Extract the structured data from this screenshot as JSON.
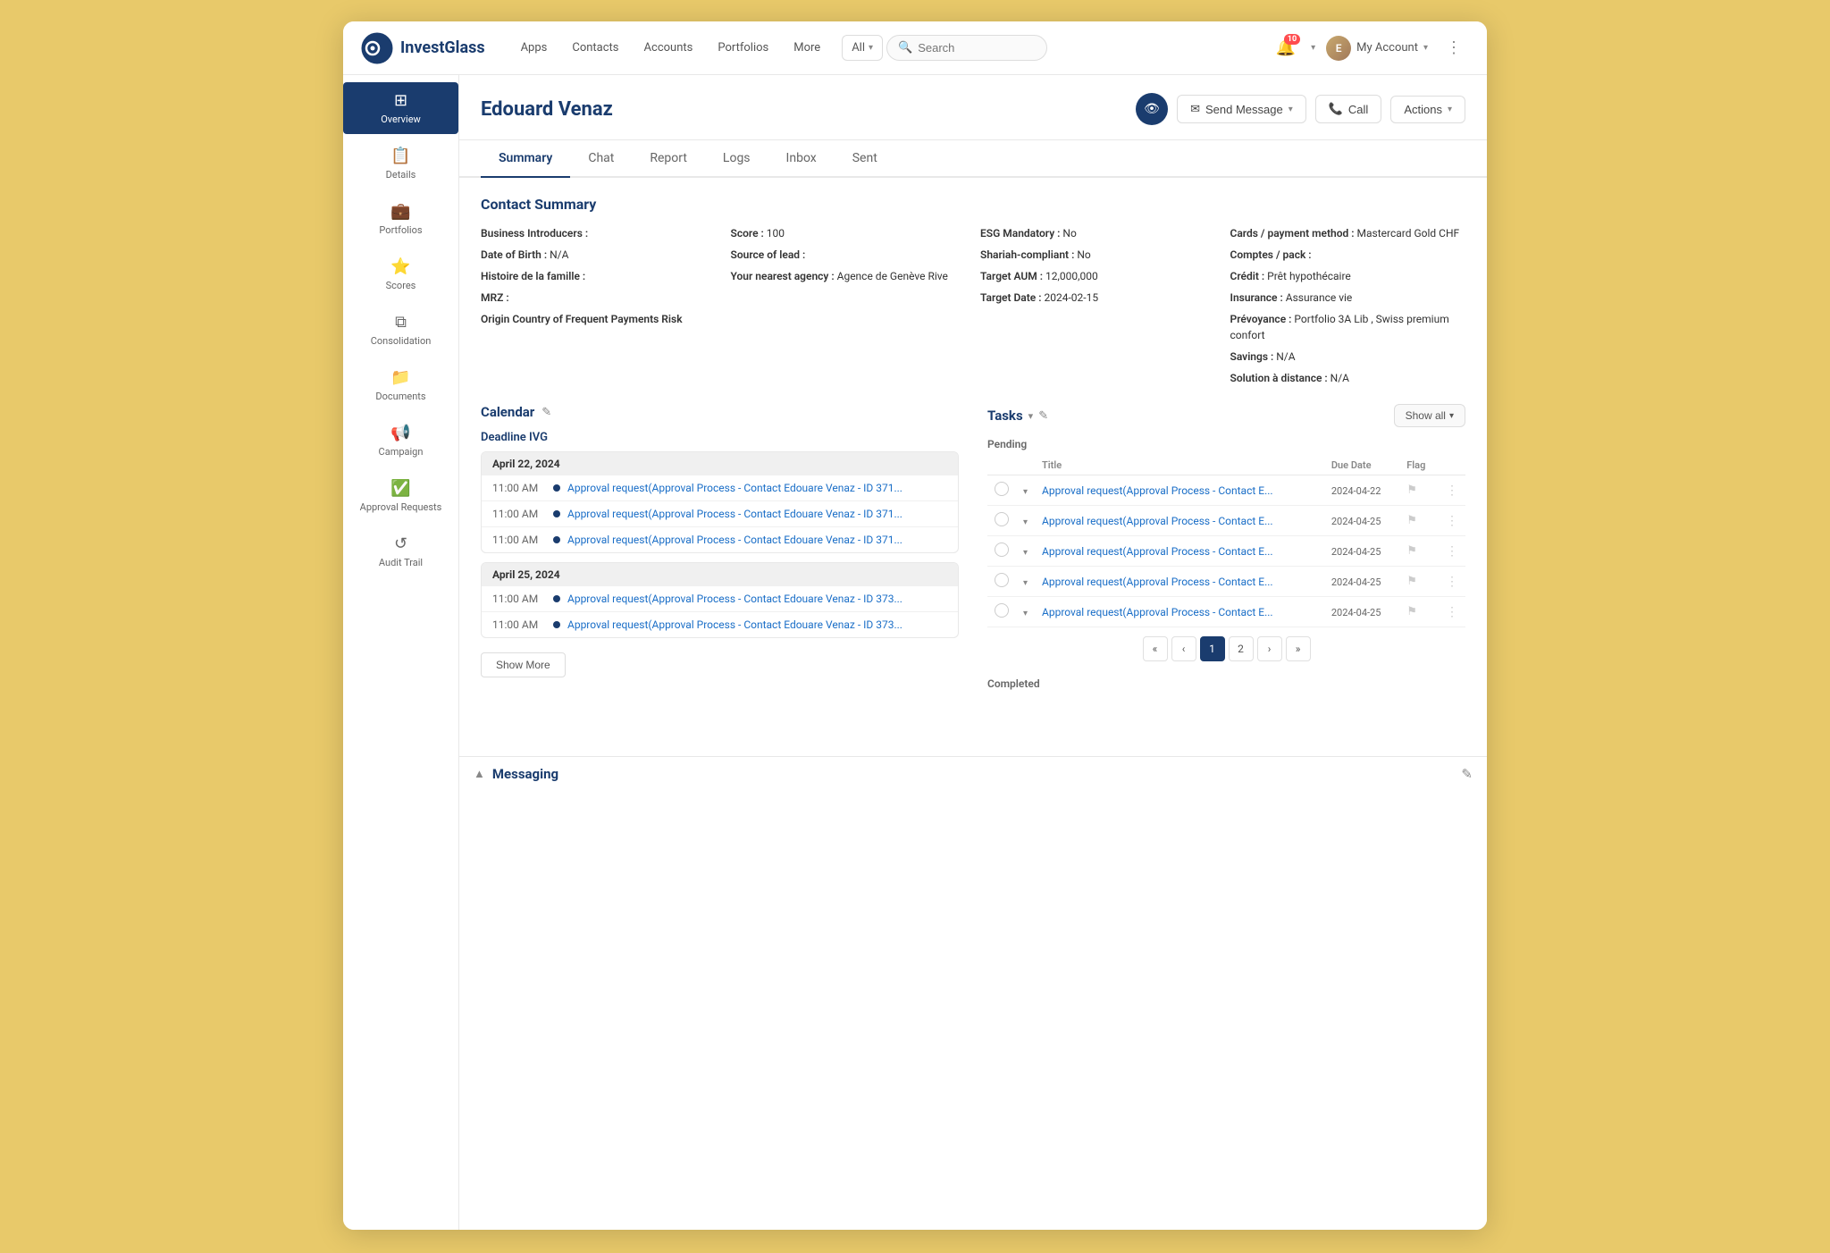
{
  "logo": {
    "text": "InvestGlass"
  },
  "nav": {
    "links": [
      "Apps",
      "Contacts",
      "Accounts",
      "Portfolios",
      "More"
    ],
    "all_dropdown": "All",
    "search_placeholder": "Search",
    "bell_count": "10",
    "my_account": "My Account",
    "more_dots": "⋮"
  },
  "sidebar": {
    "items": [
      {
        "id": "overview",
        "label": "Overview",
        "icon": "⊞",
        "active": true
      },
      {
        "id": "details",
        "label": "Details",
        "icon": "📋"
      },
      {
        "id": "portfolios",
        "label": "Portfolios",
        "icon": "💼"
      },
      {
        "id": "scores",
        "label": "Scores",
        "icon": "⭐"
      },
      {
        "id": "consolidation",
        "label": "Consolidation",
        "icon": "⧉"
      },
      {
        "id": "documents",
        "label": "Documents",
        "icon": "📁"
      },
      {
        "id": "campaign",
        "label": "Campaign",
        "icon": "📢"
      },
      {
        "id": "approval_requests",
        "label": "Approval Requests",
        "icon": "✅"
      },
      {
        "id": "audit_trail",
        "label": "Audit Trail",
        "icon": "↺"
      }
    ]
  },
  "contact": {
    "name": "Edouard Venaz",
    "actions": {
      "send_message": "Send Message",
      "call": "Call",
      "actions": "Actions"
    }
  },
  "tabs": [
    {
      "id": "summary",
      "label": "Summary",
      "active": true
    },
    {
      "id": "chat",
      "label": "Chat"
    },
    {
      "id": "report",
      "label": "Report"
    },
    {
      "id": "logs",
      "label": "Logs"
    },
    {
      "id": "inbox",
      "label": "Inbox"
    },
    {
      "id": "sent",
      "label": "Sent"
    }
  ],
  "summary": {
    "title": "Contact Summary",
    "col1": {
      "business_introducers_label": "Business Introducers :",
      "business_introducers_value": "",
      "dob_label": "Date of Birth :",
      "dob_value": "N/A",
      "famille_label": "Histoire de la famille :",
      "famille_value": "",
      "mrz_label": "MRZ :",
      "mrz_value": "",
      "origin_label": "Origin Country of Frequent Payments Risk",
      "origin_value": ""
    },
    "col2": {
      "score_label": "Score :",
      "score_value": "100",
      "source_label": "Source of lead :",
      "source_value": "",
      "agency_label": "Your nearest agency :",
      "agency_value": "Agence de Genève Rive"
    },
    "col3": {
      "esg_label": "ESG Mandatory :",
      "esg_value": "No",
      "shariah_label": "Shariah-compliant :",
      "shariah_value": "No",
      "target_aum_label": "Target AUM :",
      "target_aum_value": "12,000,000",
      "target_date_label": "Target Date :",
      "target_date_value": "2024-02-15"
    },
    "col4": {
      "cards_label": "Cards / payment method :",
      "cards_value": "Mastercard Gold CHF",
      "comptes_label": "Comptes / pack :",
      "credit_label": "Crédit :",
      "credit_value": "Prêt hypothécaire",
      "insurance_label": "Insurance :",
      "insurance_value": "Assurance vie",
      "prevoyance_label": "Prévoyance :",
      "prevoyance_value": "Portfolio 3A Lib   , Swiss premium confort",
      "savings_label": "Savings :",
      "savings_value": "N/A",
      "solution_label": "Solution à distance :",
      "solution_value": "N/A"
    }
  },
  "calendar": {
    "title": "Calendar",
    "deadline_label": "Deadline IVG",
    "date_groups": [
      {
        "date": "April 22, 2024",
        "events": [
          {
            "time": "11:00 AM",
            "title": "Approval request(Approval Process - Contact Edouare Venaz - ID 371..."
          },
          {
            "time": "11:00 AM",
            "title": "Approval request(Approval Process - Contact Edouare Venaz - ID 371..."
          },
          {
            "time": "11:00 AM",
            "title": "Approval request(Approval Process - Contact Edouare Venaz - ID 371..."
          }
        ]
      },
      {
        "date": "April 25, 2024",
        "events": [
          {
            "time": "11:00 AM",
            "title": "Approval request(Approval Process - Contact Edouare Venaz - ID 373..."
          },
          {
            "time": "11:00 AM",
            "title": "Approval request(Approval Process - Contact Edouare Venaz - ID 373..."
          }
        ]
      }
    ],
    "show_more": "Show More"
  },
  "tasks": {
    "title": "Tasks",
    "show_all": "Show all",
    "pending_label": "Pending",
    "completed_label": "Completed",
    "columns": {
      "title": "Title",
      "due_date": "Due Date",
      "flag": "Flag"
    },
    "pending_items": [
      {
        "title": "Approval request(Approval Process - Contact E...",
        "due_date": "2024-04-22"
      },
      {
        "title": "Approval request(Approval Process - Contact E...",
        "due_date": "2024-04-25"
      },
      {
        "title": "Approval request(Approval Process - Contact E...",
        "due_date": "2024-04-25"
      },
      {
        "title": "Approval request(Approval Process - Contact E...",
        "due_date": "2024-04-25"
      },
      {
        "title": "Approval request(Approval Process - Contact E...",
        "due_date": "2024-04-25"
      }
    ],
    "pagination": {
      "first": "«",
      "prev": "‹",
      "page1": "1",
      "page2": "2",
      "next": "›",
      "last": "»"
    }
  },
  "messaging": {
    "label": "Messaging",
    "collapse_icon": "▲",
    "edit_icon": "✎"
  }
}
